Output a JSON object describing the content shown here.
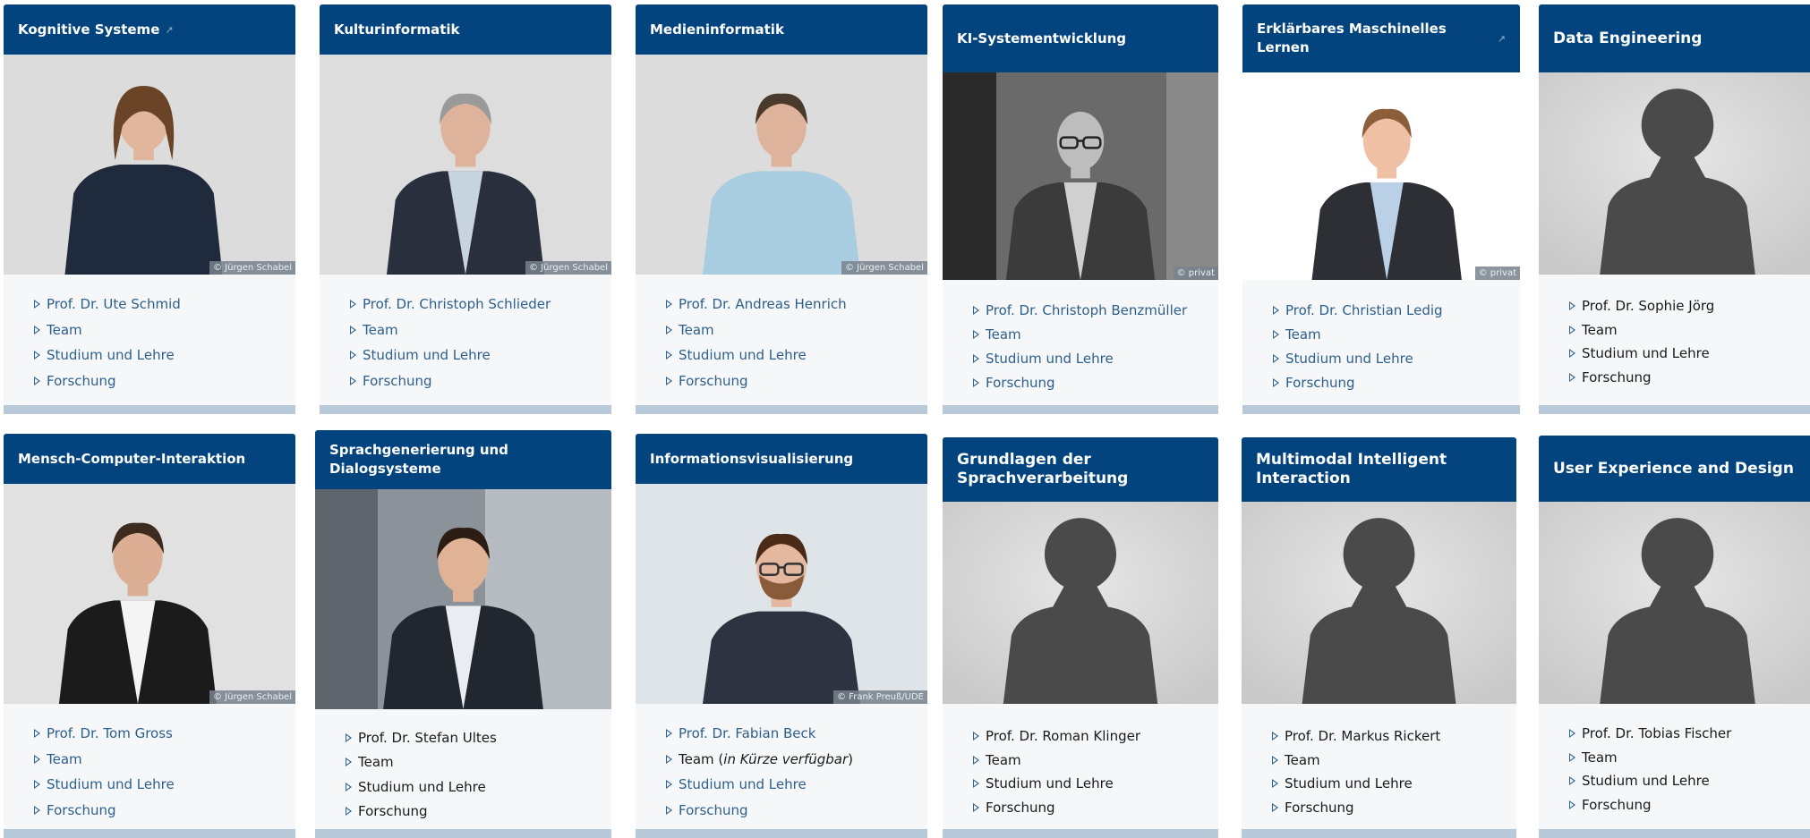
{
  "cards": [
    {
      "id": "kognitive-systeme",
      "title": "Kognitive Systeme",
      "external": true,
      "photo": "woman-portrait",
      "credit": "© Jürgen Schabel",
      "links": [
        {
          "label": "Prof. Dr. Ute Schmid"
        },
        {
          "label": "Team"
        },
        {
          "label": "Studium und Lehre"
        },
        {
          "label": "Forschung"
        }
      ]
    },
    {
      "id": "kulturinformatik",
      "title": "Kulturinformatik",
      "external": false,
      "photo": "man-grey-hair-portrait",
      "credit": "© Jürgen Schabel",
      "links": [
        {
          "label": "Prof. Dr. Christoph Schlieder"
        },
        {
          "label": "Team"
        },
        {
          "label": "Studium und Lehre"
        },
        {
          "label": "Forschung"
        }
      ]
    },
    {
      "id": "medieninformatik",
      "title": "Medieninformatik",
      "external": false,
      "photo": "man-blue-shirt-portrait",
      "credit": "© Jürgen Schabel",
      "links": [
        {
          "label": "Prof. Dr. Andreas Henrich"
        },
        {
          "label": "Team"
        },
        {
          "label": "Studium und Lehre"
        },
        {
          "label": "Forschung"
        }
      ]
    },
    {
      "id": "ki-systementwicklung",
      "title": "KI-Systementwicklung",
      "external": false,
      "photo": "man-glasses-bw-portrait",
      "credit": "© privat",
      "links": [
        {
          "label": "Prof. Dr. Christoph Benzmüller"
        },
        {
          "label": "Team"
        },
        {
          "label": "Studium und Lehre"
        },
        {
          "label": "Forschung"
        }
      ]
    },
    {
      "id": "erklaerbares-ml",
      "title": "Erklärbares Maschinelles Lernen",
      "external": true,
      "photo": "man-suit-smiling-portrait",
      "credit": "© privat",
      "links": [
        {
          "label": "Prof. Dr. Christian Ledig"
        },
        {
          "label": "Team"
        },
        {
          "label": "Studium und Lehre"
        },
        {
          "label": "Forschung"
        }
      ]
    },
    {
      "id": "data-engineering",
      "title": "Data Engineering",
      "external": false,
      "photo": "silhouette-placeholder",
      "credit": "",
      "links": [
        {
          "label": "Prof. Dr. Sophie Jörg"
        },
        {
          "label": "Team"
        },
        {
          "label": "Studium und Lehre"
        },
        {
          "label": "Forschung"
        }
      ]
    },
    {
      "id": "mensch-computer-interaktion",
      "title": "Mensch-Computer-Interaktion",
      "external": false,
      "photo": "man-black-jacket-portrait",
      "credit": "© Jürgen Schabel",
      "links": [
        {
          "label": "Prof. Dr. Tom Gross"
        },
        {
          "label": "Team"
        },
        {
          "label": "Studium und Lehre"
        },
        {
          "label": "Forschung"
        }
      ]
    },
    {
      "id": "sprachgenerierung",
      "title": "Sprachgenerierung und Dialogsysteme",
      "external": false,
      "photo": "man-smiling-outdoor-portrait",
      "credit": "",
      "links": [
        {
          "label": "Prof. Dr. Stefan Ultes"
        },
        {
          "label": "Team"
        },
        {
          "label": "Studium und Lehre"
        },
        {
          "label": "Forschung"
        }
      ]
    },
    {
      "id": "informationsvisualisierung",
      "title": "Informationsvisualisierung",
      "external": false,
      "photo": "man-glasses-beard-portrait",
      "credit": "© Frank Preuß/UDE",
      "links": [
        {
          "label": "Prof. Dr. Fabian Beck"
        },
        {
          "label": "Team",
          "suffix_open": " (",
          "suffix_italic": "in Kürze verfügbar",
          "suffix_close": ")"
        },
        {
          "label": "Studium und Lehre"
        },
        {
          "label": "Forschung"
        }
      ]
    },
    {
      "id": "grundlagen-sprachverarbeitung",
      "title": "Grundlagen der Sprachverarbeitung",
      "external": false,
      "photo": "silhouette-placeholder",
      "credit": "",
      "links": [
        {
          "label": "Prof. Dr. Roman Klinger"
        },
        {
          "label": "Team"
        },
        {
          "label": "Studium und Lehre"
        },
        {
          "label": "Forschung"
        }
      ]
    },
    {
      "id": "multimodal-interaction",
      "title": "Multimodal Intelligent Interaction",
      "external": false,
      "photo": "silhouette-placeholder",
      "credit": "",
      "links": [
        {
          "label": "Prof. Dr. Markus Rickert"
        },
        {
          "label": "Team"
        },
        {
          "label": "Studium und Lehre"
        },
        {
          "label": "Forschung"
        }
      ]
    },
    {
      "id": "ux-design",
      "title": "User Experience and Design",
      "external": false,
      "photo": "silhouette-placeholder",
      "credit": "",
      "links": [
        {
          "label": "Prof. Dr. Tobias Fischer"
        },
        {
          "label": "Team"
        },
        {
          "label": "Studium und Lehre"
        },
        {
          "label": "Forschung"
        }
      ]
    }
  ]
}
